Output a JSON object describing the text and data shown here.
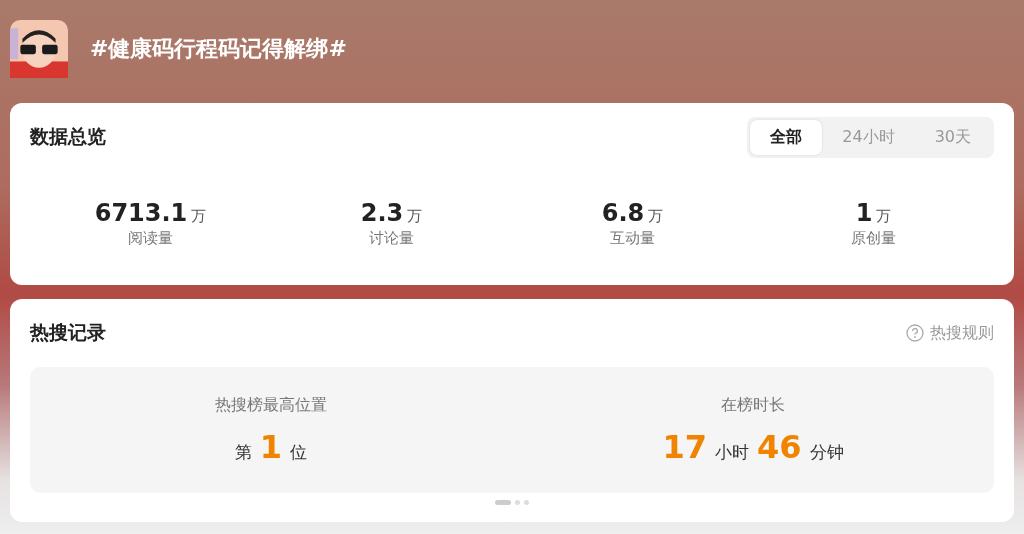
{
  "topic": {
    "title": "#健康码行程码记得解绑#"
  },
  "overview": {
    "title": "数据总览",
    "tabs": [
      {
        "label": "全部",
        "selected": true
      },
      {
        "label": "24小时",
        "selected": false
      },
      {
        "label": "30天",
        "selected": false
      }
    ],
    "stats": [
      {
        "value": "6713.1",
        "unit": "万",
        "label": "阅读量"
      },
      {
        "value": "2.3",
        "unit": "万",
        "label": "讨论量"
      },
      {
        "value": "6.8",
        "unit": "万",
        "label": "互动量"
      },
      {
        "value": "1",
        "unit": "万",
        "label": "原创量"
      }
    ]
  },
  "hot_search": {
    "title": "热搜记录",
    "rules_link": "热搜规则",
    "items": [
      {
        "label": "热搜榜最高位置",
        "parts": [
          {
            "kind": "unit",
            "text": "第"
          },
          {
            "kind": "number",
            "text": "1"
          },
          {
            "kind": "unit",
            "text": "位"
          }
        ]
      },
      {
        "label": "在榜时长",
        "parts": [
          {
            "kind": "number",
            "text": "17"
          },
          {
            "kind": "unit",
            "text": "小时"
          },
          {
            "kind": "number",
            "text": "46"
          },
          {
            "kind": "unit",
            "text": "分钟"
          }
        ]
      }
    ],
    "pager": [
      {
        "selected": true
      },
      {
        "selected": false
      },
      {
        "selected": false
      }
    ]
  }
}
